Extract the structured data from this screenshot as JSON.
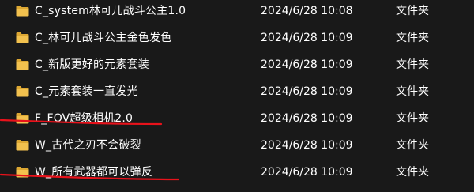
{
  "files": [
    {
      "name": "C_system林可儿战斗公主1.0",
      "date": "2024/6/28 10:08",
      "type": "文件夹",
      "icon": "folder-icon"
    },
    {
      "name": "C_林可儿战斗公主金色发色",
      "date": "2024/6/28 10:09",
      "type": "文件夹",
      "icon": "folder-icon"
    },
    {
      "name": "C_新版更好的元素套装",
      "date": "2024/6/28 10:09",
      "type": "文件夹",
      "icon": "folder-icon"
    },
    {
      "name": "C_元素套装一直发光",
      "date": "2024/6/28 10:09",
      "type": "文件夹",
      "icon": "folder-icon"
    },
    {
      "name": "F_FOV超级相机2.0",
      "date": "2024/6/28 10:09",
      "type": "文件夹",
      "icon": "folder-icon"
    },
    {
      "name": "W_古代之刃不会破裂",
      "date": "2024/6/28 10:09",
      "type": "文件夹",
      "icon": "folder-icon"
    },
    {
      "name": "W_所有武器都可以弹反",
      "date": "2024/6/28 10:09",
      "type": "文件夹",
      "icon": "folder-icon"
    }
  ],
  "colors": {
    "background": "#191919",
    "text": "#ffffff",
    "folder": "#f2c14e",
    "folder_dark": "#dca733",
    "annotation_stroke": "#e8121b"
  }
}
